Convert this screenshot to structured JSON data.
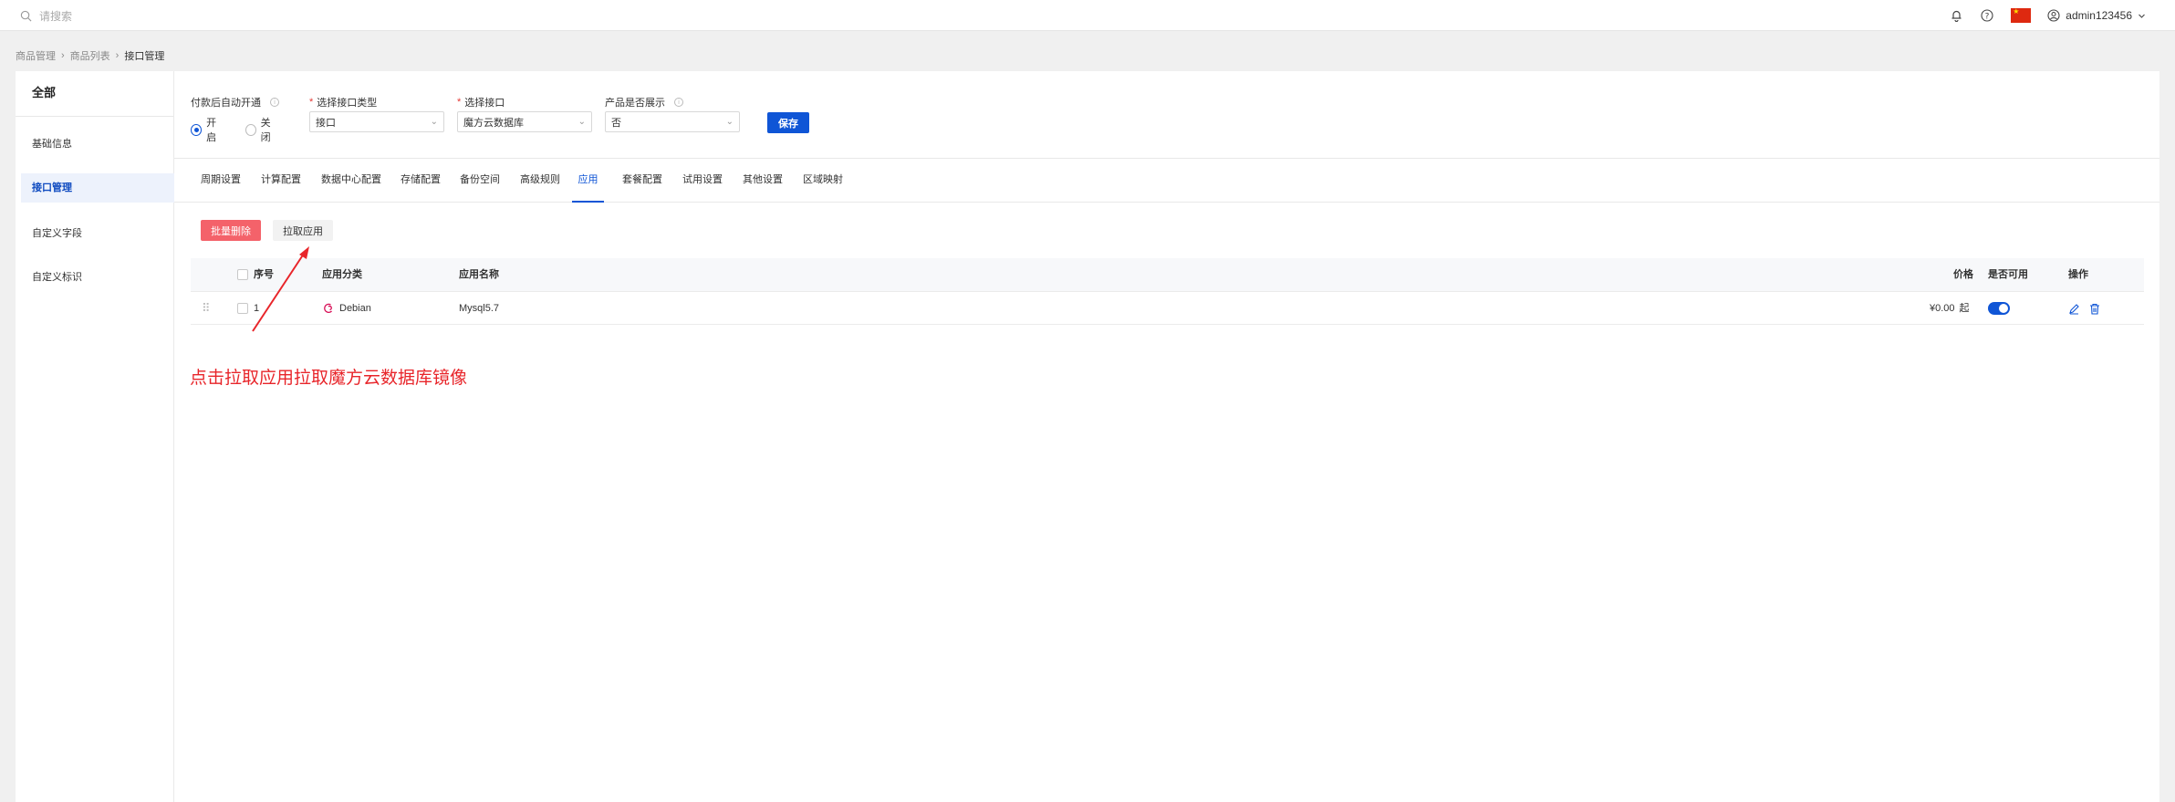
{
  "topbar": {
    "search_placeholder": "请搜索",
    "username": "admin123456",
    "icons": [
      "search-icon",
      "bell-icon",
      "help-icon",
      "china-flag-icon",
      "user-icon",
      "chevron-down-icon"
    ]
  },
  "breadcrumb": [
    "商品管理",
    "商品列表",
    "接口管理"
  ],
  "sidebar": {
    "header": "全部",
    "items": [
      {
        "label": "基础信息",
        "active": false
      },
      {
        "label": "接口管理",
        "active": true
      },
      {
        "label": "自定义字段",
        "active": false
      },
      {
        "label": "自定义标识",
        "active": false
      }
    ]
  },
  "filters": {
    "auto_open": {
      "label": "付款后自动开通",
      "options": [
        "开启",
        "关闭"
      ],
      "selected": "开启"
    },
    "interface_type": {
      "label": "选择接口类型",
      "value": "接口"
    },
    "interface": {
      "label": "选择接口",
      "value": "魔方云数据库"
    },
    "product_display": {
      "label": "产品是否展示",
      "value": "否"
    },
    "save_label": "保存"
  },
  "tabs": [
    {
      "label": "周期设置",
      "active": false
    },
    {
      "label": "计算配置",
      "active": false
    },
    {
      "label": "数据中心配置",
      "active": false
    },
    {
      "label": "存储配置",
      "active": false
    },
    {
      "label": "备份空间",
      "active": false
    },
    {
      "label": "高级规则",
      "active": false
    },
    {
      "label": "应用",
      "active": true
    },
    {
      "label": "套餐配置",
      "active": false
    },
    {
      "label": "试用设置",
      "active": false
    },
    {
      "label": "其他设置",
      "active": false
    },
    {
      "label": "区域映射",
      "active": false
    }
  ],
  "actions": {
    "batch_delete": "批量删除",
    "pull_app": "拉取应用"
  },
  "table": {
    "headers": {
      "index": "序号",
      "category": "应用分类",
      "name": "应用名称",
      "price": "价格",
      "enabled": "是否可用",
      "ops": "操作"
    },
    "rows": [
      {
        "index": "1",
        "category": "Debian",
        "name": "Mysql5.7",
        "price": "¥0.00",
        "price_suffix": "起",
        "enabled": true
      }
    ]
  },
  "annotation": "点击拉取应用拉取魔方云数据库镜像",
  "colors": {
    "primary": "#0f55d6",
    "danger": "#f4626a",
    "annotation": "#e8252a"
  }
}
